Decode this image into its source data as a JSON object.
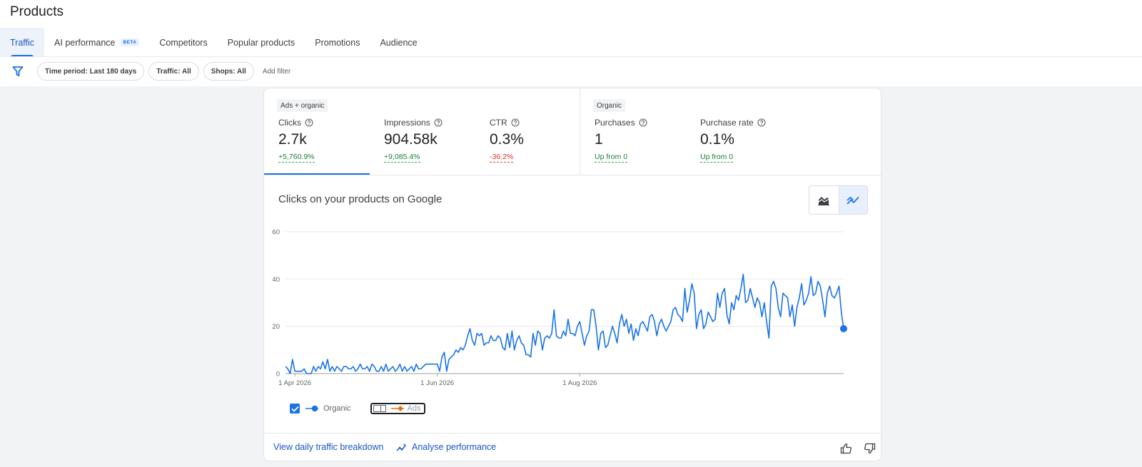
{
  "page": {
    "title": "Products"
  },
  "tabs": [
    {
      "label": "Traffic",
      "active": true
    },
    {
      "label": "AI performance",
      "badge": "BETA"
    },
    {
      "label": "Competitors"
    },
    {
      "label": "Popular products"
    },
    {
      "label": "Promotions"
    },
    {
      "label": "Audience"
    }
  ],
  "filters": {
    "chips": [
      "Time period: Last 180 days",
      "Traffic: All",
      "Shops: All"
    ],
    "add_label": "Add filter"
  },
  "metrics": {
    "groups": [
      "Ads + organic",
      "Organic"
    ],
    "items": [
      {
        "label": "Clicks",
        "value": "2.7k",
        "delta": "+5,760.9%",
        "trend": "up",
        "selected": true
      },
      {
        "label": "Impressions",
        "value": "904.58k",
        "delta": "+9,085.4%",
        "trend": "up"
      },
      {
        "label": "CTR",
        "value": "0.3%",
        "delta": "-36.2%",
        "trend": "down"
      },
      {
        "label": "Purchases",
        "value": "1",
        "delta": "Up from 0",
        "trend": "up"
      },
      {
        "label": "Purchase rate",
        "value": "0.1%",
        "delta": "Up from 0",
        "trend": "up"
      }
    ]
  },
  "chart": {
    "title": "Clicks on your products on Google",
    "view_toggle": [
      "area-chart-icon",
      "line-chart-icon"
    ],
    "active_view": "line-chart-icon",
    "legend": [
      {
        "label": "Organic",
        "checked": true,
        "color": "#1a73e8"
      },
      {
        "label": "Ads",
        "checked": false,
        "color": "#e8710a"
      }
    ]
  },
  "chart_data": {
    "type": "line",
    "title": "Clicks on your products on Google",
    "xlabel": "",
    "ylabel": "",
    "ylim": [
      0,
      60
    ],
    "yticks": [
      0,
      20,
      40,
      60
    ],
    "x_start": "2026-03-28",
    "x_tick_labels": [
      {
        "date": "2026-04-01",
        "label": "1 Apr 2026"
      },
      {
        "date": "2026-06-01",
        "label": "1 Jun 2026"
      },
      {
        "date": "2026-08-01",
        "label": "1 Aug 2026"
      }
    ],
    "grid": true,
    "series": [
      {
        "name": "Organic",
        "color": "#1a73e8",
        "values": [
          3,
          2,
          0,
          6,
          1,
          1,
          1,
          1,
          2,
          0,
          0,
          0,
          3,
          1,
          3,
          2,
          5,
          2,
          6,
          1,
          3,
          1,
          3,
          2,
          1,
          3,
          3,
          2,
          2,
          3,
          1,
          2,
          4,
          2,
          2,
          3,
          1,
          4,
          3,
          1,
          1,
          3,
          1,
          4,
          1,
          2,
          3,
          1,
          2,
          4,
          1,
          3,
          1,
          2,
          3,
          1,
          4,
          2,
          2,
          3,
          4,
          4,
          4,
          4,
          4,
          4,
          1,
          7,
          9,
          1,
          6,
          7,
          8,
          10,
          9,
          11,
          10,
          12,
          16,
          19,
          14,
          12,
          17,
          16,
          17,
          12,
          13,
          13,
          16,
          14,
          14,
          16,
          15,
          11,
          10,
          17,
          11,
          18,
          10,
          14,
          16,
          13,
          12,
          8,
          8,
          7,
          17,
          12,
          18,
          17,
          10,
          15,
          16,
          15,
          17,
          27,
          16,
          15,
          15,
          18,
          16,
          23,
          17,
          17,
          16,
          20,
          22,
          17,
          12,
          16,
          18,
          27,
          27,
          20,
          10,
          17,
          18,
          11,
          12,
          16,
          20,
          17,
          13,
          21,
          25,
          20,
          23,
          17,
          21,
          14,
          19,
          16,
          21,
          22,
          20,
          18,
          24,
          25,
          22,
          16,
          21,
          23,
          20,
          18,
          20,
          22,
          27,
          28,
          25,
          24,
          22,
          36,
          26,
          31,
          38,
          34,
          19,
          25,
          27,
          19,
          21,
          26,
          24,
          22,
          23,
          34,
          28,
          34,
          36,
          25,
          21,
          30,
          27,
          33,
          31,
          36,
          42,
          30,
          31,
          36,
          32,
          28,
          32,
          30,
          24,
          30,
          22,
          15,
          37,
          39,
          36,
          28,
          24,
          34,
          33,
          32,
          24,
          29,
          20,
          28,
          32,
          38,
          29,
          31,
          34,
          41,
          33,
          34,
          39,
          37,
          31,
          24,
          34,
          37,
          33,
          32,
          34,
          37,
          26,
          19
        ],
        "last_point": 19
      },
      {
        "name": "Ads",
        "color": "#e8710a",
        "visible": false
      }
    ]
  },
  "footer": {
    "links": [
      "View daily traffic breakdown",
      "Analyse performance"
    ],
    "feedback_icons": [
      "thumbs-up-icon",
      "thumbs-down-icon"
    ]
  }
}
